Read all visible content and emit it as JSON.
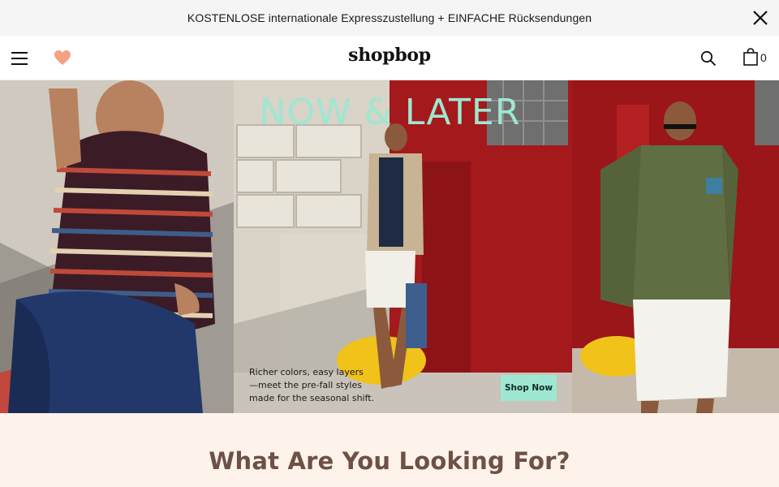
{
  "promo": {
    "text": "KOSTENLOSE internationale Expresszustellung + EINFACHE Rücksendungen",
    "close_icon": "close-icon"
  },
  "header": {
    "logo": "shopbop",
    "menu_icon": "hamburger-icon",
    "wishlist_icon": "heart-icon",
    "search_icon": "search-icon",
    "bag_icon": "shopping-bag-icon",
    "bag_count": "0"
  },
  "hero": {
    "title": "NOW & LATER",
    "copy": [
      "Richer colors, easy layers",
      "—meet the pre-fall styles",
      "made for the seasonal shift."
    ],
    "cta_label": "Shop Now"
  },
  "section": {
    "title": "What Are You Looking For?"
  },
  "colors": {
    "promo_bg": "#f5f5f5",
    "heart": "#f4a282",
    "hero_accent": "#9ee7d2",
    "section_bg": "#fdf3ea",
    "section_title": "#6e5046"
  }
}
